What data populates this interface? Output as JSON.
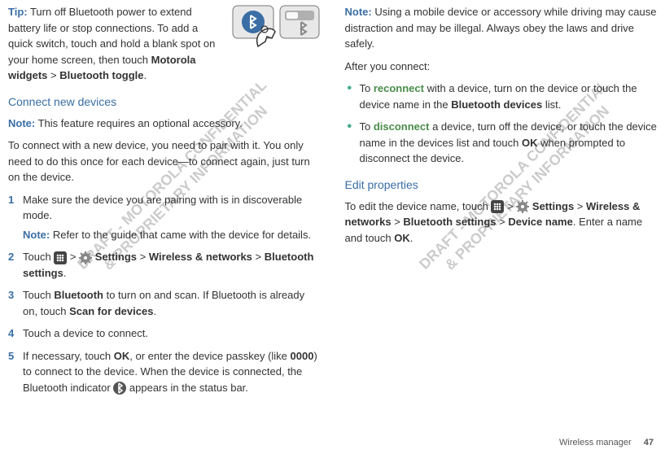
{
  "left": {
    "tip_label": "Tip:",
    "tip_text_1": " Turn off Bluetooth power to extend battery life or stop connections. To add a quick switch, touch and hold a blank spot on your home screen, then touch ",
    "tip_bold_1": "Motorola widgets",
    "tip_gt_1": " > ",
    "tip_bold_2": "Bluetooth toggle",
    "tip_period": ".",
    "heading_connect": "Connect new devices",
    "note1_label": "Note:",
    "note1_text": " This feature requires an optional accessory.",
    "para_connect": "To connect with a new device, you need to pair with it. You only need to do this once for each device—to connect again, just turn on the device.",
    "li1_num": "1",
    "li1_text": "Make sure the device you are pairing with is in discoverable mode.",
    "li1_note_label": "Note:",
    "li1_note_text": " Refer to the guide that came with the device for details.",
    "li2_num": "2",
    "li2_touch": "Touch ",
    "li2_gt1": " > ",
    "li2_settings": " Settings",
    "li2_gt2": " > ",
    "li2_wireless": "Wireless & networks",
    "li2_gt3": " > ",
    "li2_btsettings": "Bluetooth settings",
    "li2_period": ".",
    "li3_num": "3",
    "li3_t1": "Touch ",
    "li3_bt": "Bluetooth",
    "li3_t2": " to turn on and scan. If Bluetooth is already on, touch ",
    "li3_scan": "Scan for devices",
    "li3_period": ".",
    "li4_num": "4",
    "li4_text": "Touch a device to connect.",
    "li5_num": "5",
    "li5_t1": "If necessary, touch ",
    "li5_ok": "OK",
    "li5_t2": ", or enter the device passkey (like ",
    "li5_0000": "0000",
    "li5_t3": ") to connect to the device. When the device is connected, the Bluetooth indicator ",
    "li5_t4": " appears in the status bar."
  },
  "right": {
    "note_label": "Note:",
    "note_text": " Using a mobile device or accessory while driving may cause distraction and may be illegal. Always obey the laws and drive safely.",
    "after_connect": "After you connect:",
    "b1_t1": "To ",
    "b1_reconnect": "reconnect",
    "b1_t2": " with a device, turn on the device or touch the device name in the ",
    "b1_btdev": "Bluetooth devices",
    "b1_t3": " list.",
    "b2_t1": "To ",
    "b2_disconnect": "disconnect",
    "b2_t2": " a device, turn off the device, or touch the device name in the devices list and touch ",
    "b2_ok": "OK",
    "b2_t3": " when prompted to disconnect the device.",
    "heading_edit": "Edit properties",
    "edit_t1": "To edit the device name, touch ",
    "edit_gt1": " > ",
    "edit_settings": " Settings",
    "edit_gt2": " > ",
    "edit_wireless": "Wireless & networks",
    "edit_gt3": " > ",
    "edit_btsettings": "Bluetooth settings",
    "edit_gt4": " > ",
    "edit_devname": "Device name",
    "edit_t2": ". Enter a name and touch ",
    "edit_ok": "OK",
    "edit_period": "."
  },
  "footer": {
    "section": "Wireless manager",
    "page": "47"
  },
  "watermark": "DRAFT - MOTOROLA CONFIDENTIAL\n& PROPRIETARY INFORMATION"
}
